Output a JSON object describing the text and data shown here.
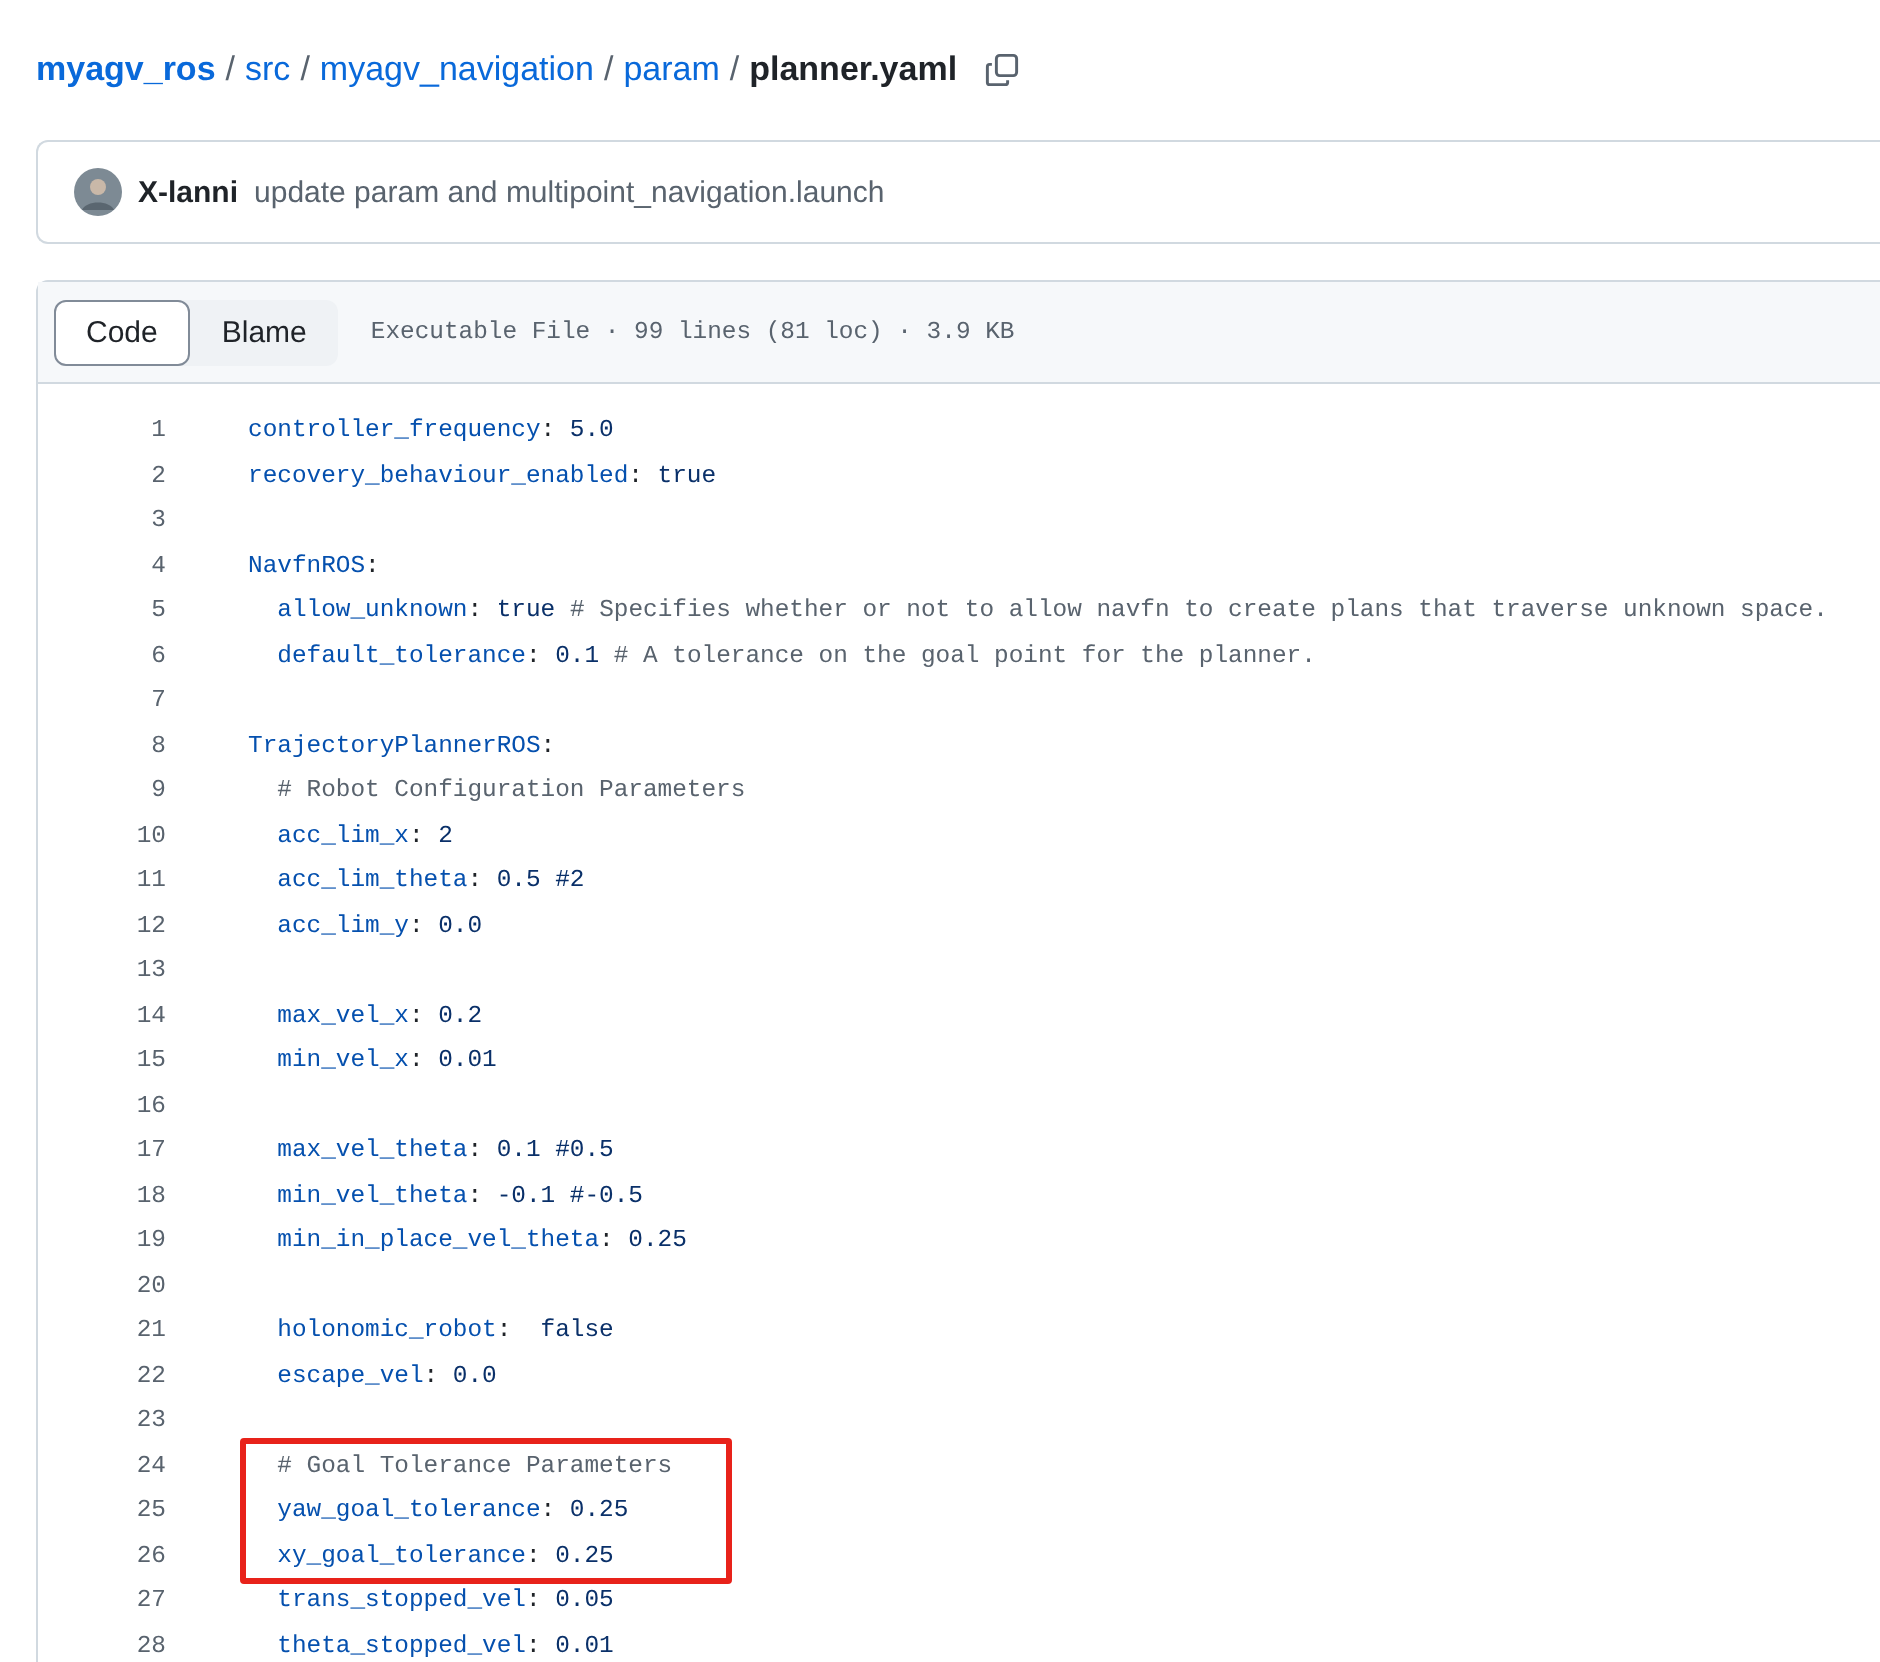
{
  "breadcrumb": {
    "links": [
      "myagv_ros",
      "src",
      "myagv_navigation",
      "param"
    ],
    "separator": "/",
    "current": "planner.yaml"
  },
  "commit": {
    "author": "X-lanni",
    "message": "update param and multipoint_navigation.launch"
  },
  "file_header": {
    "tabs": [
      {
        "label": "Code",
        "selected": true
      },
      {
        "label": "Blame",
        "selected": false
      }
    ],
    "info": "Executable File · 99 lines (81 loc) · 3.9 KB"
  },
  "lines": [
    {
      "number": "1",
      "highlighted": false,
      "segments": [
        {
          "kind": "key",
          "text": "controller_frequency"
        },
        {
          "kind": "plain",
          "text": ": "
        },
        {
          "kind": "value",
          "text": "5.0"
        }
      ]
    },
    {
      "number": "2",
      "highlighted": false,
      "segments": [
        {
          "kind": "key",
          "text": "recovery_behaviour_enabled"
        },
        {
          "kind": "plain",
          "text": ": "
        },
        {
          "kind": "value",
          "text": "true"
        }
      ]
    },
    {
      "number": "3",
      "highlighted": false
    },
    {
      "number": "4",
      "highlighted": false,
      "segments": [
        {
          "kind": "key",
          "text": "NavfnROS"
        },
        {
          "kind": "plain",
          "text": ":"
        }
      ]
    },
    {
      "number": "5",
      "highlighted": false,
      "segments": [
        {
          "kind": "key",
          "text": "  allow_unknown"
        },
        {
          "kind": "plain",
          "text": ": "
        },
        {
          "kind": "value",
          "text": "true"
        },
        {
          "kind": "comment",
          "text": " # Specifies whether or not to allow navfn to create plans that traverse unknown space."
        }
      ]
    },
    {
      "number": "6",
      "highlighted": false,
      "segments": [
        {
          "kind": "key",
          "text": "  default_tolerance"
        },
        {
          "kind": "plain",
          "text": ": "
        },
        {
          "kind": "value",
          "text": "0.1"
        },
        {
          "kind": "comment",
          "text": " # A tolerance on the goal point for the planner."
        }
      ]
    },
    {
      "number": "7",
      "highlighted": false
    },
    {
      "number": "8",
      "highlighted": false,
      "segments": [
        {
          "kind": "key",
          "text": "TrajectoryPlannerROS"
        },
        {
          "kind": "plain",
          "text": ":"
        }
      ]
    },
    {
      "number": "9",
      "highlighted": false,
      "segments": [
        {
          "kind": "comment",
          "text": "  # Robot Configuration Parameters"
        }
      ]
    },
    {
      "number": "10",
      "highlighted": false,
      "segments": [
        {
          "kind": "key",
          "text": "  acc_lim_x"
        },
        {
          "kind": "plain",
          "text": ": "
        },
        {
          "kind": "value",
          "text": "2"
        }
      ]
    },
    {
      "number": "11",
      "highlighted": false,
      "segments": [
        {
          "kind": "key",
          "text": "  acc_lim_theta"
        },
        {
          "kind": "plain",
          "text": ": "
        },
        {
          "kind": "value",
          "text": "0.5 #2"
        }
      ]
    },
    {
      "number": "12",
      "highlighted": false,
      "segments": [
        {
          "kind": "key",
          "text": "  acc_lim_y"
        },
        {
          "kind": "plain",
          "text": ": "
        },
        {
          "kind": "value",
          "text": "0.0"
        }
      ]
    },
    {
      "number": "13",
      "highlighted": false
    },
    {
      "number": "14",
      "highlighted": false,
      "segments": [
        {
          "kind": "key",
          "text": "  max_vel_x"
        },
        {
          "kind": "plain",
          "text": ": "
        },
        {
          "kind": "value",
          "text": "0.2"
        }
      ]
    },
    {
      "number": "15",
      "highlighted": false,
      "segments": [
        {
          "kind": "key",
          "text": "  min_vel_x"
        },
        {
          "kind": "plain",
          "text": ": "
        },
        {
          "kind": "value",
          "text": "0.01"
        }
      ]
    },
    {
      "number": "16",
      "highlighted": false
    },
    {
      "number": "17",
      "highlighted": false,
      "segments": [
        {
          "kind": "key",
          "text": "  max_vel_theta"
        },
        {
          "kind": "plain",
          "text": ": "
        },
        {
          "kind": "value",
          "text": "0.1 #0.5"
        }
      ]
    },
    {
      "number": "18",
      "highlighted": false,
      "segments": [
        {
          "kind": "key",
          "text": "  min_vel_theta"
        },
        {
          "kind": "plain",
          "text": ": "
        },
        {
          "kind": "value",
          "text": "-0.1 #-0.5"
        }
      ]
    },
    {
      "number": "19",
      "highlighted": false,
      "segments": [
        {
          "kind": "key",
          "text": "  min_in_place_vel_theta"
        },
        {
          "kind": "plain",
          "text": ": "
        },
        {
          "kind": "value",
          "text": "0.25"
        }
      ]
    },
    {
      "number": "20",
      "highlighted": false
    },
    {
      "number": "21",
      "highlighted": false,
      "segments": [
        {
          "kind": "key",
          "text": "  holonomic_robot"
        },
        {
          "kind": "plain",
          "text": ":  "
        },
        {
          "kind": "value",
          "text": "false"
        }
      ]
    },
    {
      "number": "22",
      "highlighted": false,
      "segments": [
        {
          "kind": "key",
          "text": "  escape_vel"
        },
        {
          "kind": "plain",
          "text": ": "
        },
        {
          "kind": "value",
          "text": "0.0"
        }
      ]
    },
    {
      "number": "23",
      "highlighted": false
    },
    {
      "number": "24",
      "highlighted": true,
      "segments": [
        {
          "kind": "comment",
          "text": "  # Goal Tolerance Parameters"
        }
      ]
    },
    {
      "number": "25",
      "highlighted": true,
      "segments": [
        {
          "kind": "key",
          "text": "  yaw_goal_tolerance"
        },
        {
          "kind": "plain",
          "text": ": "
        },
        {
          "kind": "value",
          "text": "0.25"
        }
      ]
    },
    {
      "number": "26",
      "highlighted": true,
      "segments": [
        {
          "kind": "key",
          "text": "  xy_goal_tolerance"
        },
        {
          "kind": "plain",
          "text": ": "
        },
        {
          "kind": "value",
          "text": "0.25"
        }
      ]
    },
    {
      "number": "27",
      "highlighted": false,
      "segments": [
        {
          "kind": "key",
          "text": "  trans_stopped_vel"
        },
        {
          "kind": "plain",
          "text": ": "
        },
        {
          "kind": "value",
          "text": "0.05"
        }
      ]
    },
    {
      "number": "28",
      "highlighted": false,
      "segments": [
        {
          "kind": "key",
          "text": "  theta_stopped_vel"
        },
        {
          "kind": "plain",
          "text": ": "
        },
        {
          "kind": "value",
          "text": "0.01"
        }
      ]
    }
  ]
}
